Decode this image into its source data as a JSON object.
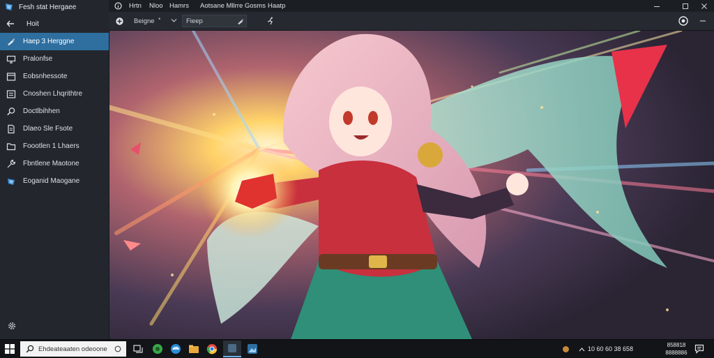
{
  "app": {
    "title": "Fesh stat Hergaee"
  },
  "menubar": {
    "items": [
      "Hrtn",
      "Nloo",
      "Hamrs",
      "Aotsane Mllrre Gosms",
      "Haatp"
    ]
  },
  "sidebar": {
    "home_label": "Hoit",
    "items": [
      {
        "label": "Haep 3 Herggne",
        "icon": "brush-icon",
        "active": true
      },
      {
        "label": "Pralonfse",
        "icon": "monitor-icon",
        "active": false
      },
      {
        "label": "Eobsnhessote",
        "icon": "window-icon",
        "active": false
      },
      {
        "label": "Cnoshen Lhqrithtre",
        "icon": "list-icon",
        "active": false
      },
      {
        "label": "Doctlbihhen",
        "icon": "search-icon",
        "active": false
      },
      {
        "label": "Dlaeo Sle Fsote",
        "icon": "document-icon",
        "active": false
      },
      {
        "label": "Foootlen 1 Lhaers",
        "icon": "folder-icon",
        "active": false
      },
      {
        "label": "Fbntlene Maotone",
        "icon": "tools-icon",
        "active": false
      },
      {
        "label": "Eoganid Maogane",
        "icon": "app-icon",
        "active": false
      }
    ]
  },
  "toolbar": {
    "preset_value": "Beigne",
    "style_value": "Fieep"
  },
  "taskbar": {
    "search_placeholder": "Ehdeateaaten odeoone",
    "tray_text": "10 60 60 38 658",
    "clock_top": "858818",
    "clock_bottom": "8888886"
  },
  "colors": {
    "accent": "#2f6fa0",
    "sidebar_bg": "#23272d",
    "taskbar_bg": "#121417"
  }
}
